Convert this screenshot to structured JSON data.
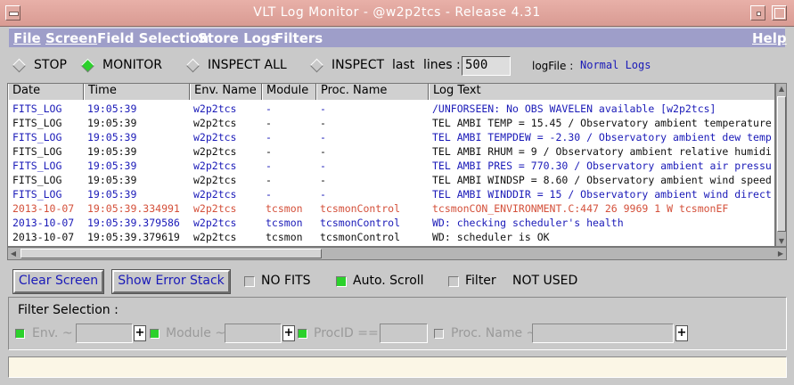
{
  "window": {
    "title": "VLT Log Monitor - @w2p2tcs - Release 4.31"
  },
  "menu": {
    "file": "File",
    "screen": "Screen",
    "field_selection": "Field Selection",
    "store_logs": "Store Logs",
    "filters": "Filters",
    "help": "Help"
  },
  "mode": {
    "stop": "STOP",
    "monitor": "MONITOR",
    "inspect_all": "INSPECT ALL",
    "inspect": "INSPECT",
    "last": "last",
    "lines_label": "lines :",
    "lines_value": "500",
    "logfile_label": "logFile :",
    "logfile_value": "Normal Logs",
    "selected": "MONITOR"
  },
  "table": {
    "headers": [
      "Date",
      "Time",
      "Env. Name",
      "Module",
      "Proc. Name",
      "Log Text"
    ],
    "rows": [
      [
        "FITS_LOG",
        "19:05:39",
        "w2p2tcs",
        "-",
        "-",
        "/UNFORSEEN: No OBS WAVELEN available [w2p2tcs]"
      ],
      [
        "FITS_LOG",
        "19:05:39",
        "w2p2tcs",
        "-",
        "-",
        "TEL AMBI TEMP = 15.45 / Observatory ambient temperature"
      ],
      [
        "FITS_LOG",
        "19:05:39",
        "w2p2tcs",
        "-",
        "-",
        "TEL AMBI TEMPDEW = -2.30 / Observatory ambient dew temp"
      ],
      [
        "FITS_LOG",
        "19:05:39",
        "w2p2tcs",
        "-",
        "-",
        "TEL AMBI RHUM = 9 / Observatory ambient relative humidi"
      ],
      [
        "FITS_LOG",
        "19:05:39",
        "w2p2tcs",
        "-",
        "-",
        "TEL AMBI PRES = 770.30 / Observatory ambient air pressu"
      ],
      [
        "FITS_LOG",
        "19:05:39",
        "w2p2tcs",
        "-",
        "-",
        "TEL AMBI WINDSP = 8.60 / Observatory ambient wind speed"
      ],
      [
        "FITS_LOG",
        "19:05:39",
        "w2p2tcs",
        "-",
        "-",
        "TEL AMBI WINDDIR = 15 / Observatory ambient wind direct"
      ],
      [
        "2013-10-07",
        "19:05:39.334991",
        "w2p2tcs",
        "tcsmon",
        "tcsmonControl",
        "tcsmonCON_ENVIRONMENT.C:447   26     9969  1 W tcsmonEF"
      ],
      [
        "2013-10-07",
        "19:05:39.379586",
        "w2p2tcs",
        "tcsmon",
        "tcsmonControl",
        "WD: checking scheduler's health"
      ],
      [
        "2013-10-07",
        "19:05:39.379619",
        "w2p2tcs",
        "tcsmon",
        "tcsmonControl",
        "WD: scheduler is OK"
      ]
    ],
    "row_colors": [
      "blue",
      "black",
      "blue",
      "black",
      "blue",
      "black",
      "blue",
      "red",
      "blue",
      "black"
    ],
    "colors": {
      "blue": "#1a1ab8",
      "black": "#111111",
      "red": "#d4503a"
    }
  },
  "controls": {
    "clear_screen": "Clear Screen",
    "show_error_stack": "Show Error Stack",
    "no_fits": "NO FITS",
    "auto_scroll": "Auto. Scroll",
    "filter": "Filter",
    "filter_status": "NOT USED"
  },
  "filter_selection": {
    "title": "Filter Selection :",
    "env": "Env. ~",
    "module": "Module ~",
    "procid": "ProcID ==",
    "procname": "Proc. Name ~",
    "plus": "+"
  }
}
